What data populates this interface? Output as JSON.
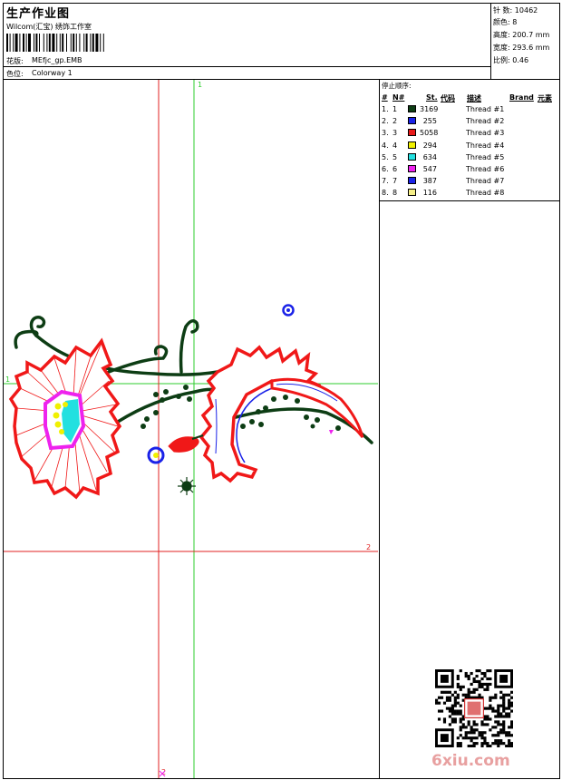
{
  "header": {
    "title": "生产作业图",
    "studio": "Wilcom(汇宝) 绣饰工作室",
    "design_label": "花版:",
    "design_name": "MEfjc_gp.EMB",
    "colorway_label": "色位:",
    "colorway_name": "Colorway 1"
  },
  "stats": [
    {
      "label": "针 数:",
      "value": "10462"
    },
    {
      "label": "颜色:",
      "value": "8"
    },
    {
      "label": "高度:",
      "value": "200.7 mm"
    },
    {
      "label": "宽度:",
      "value": "293.6 mm"
    },
    {
      "label": "比例:",
      "value": "0.46"
    }
  ],
  "stop_sequence": {
    "title": "停止顺序:",
    "columns": [
      "#",
      "N#",
      "St.",
      "代码",
      "描述",
      "Brand",
      "元素"
    ],
    "rows": [
      {
        "idx": "1.",
        "n": "1",
        "color": "#0d3d14",
        "stitches": "3169",
        "desc": "Thread #1"
      },
      {
        "idx": "2.",
        "n": "2",
        "color": "#1a22e8",
        "stitches": "255",
        "desc": "Thread #2"
      },
      {
        "idx": "3.",
        "n": "3",
        "color": "#e81a1a",
        "stitches": "5058",
        "desc": "Thread #3"
      },
      {
        "idx": "4.",
        "n": "4",
        "color": "#f0f000",
        "stitches": "294",
        "desc": "Thread #4"
      },
      {
        "idx": "5.",
        "n": "5",
        "color": "#22e0e0",
        "stitches": "634",
        "desc": "Thread #5"
      },
      {
        "idx": "6.",
        "n": "6",
        "color": "#ee22ee",
        "stitches": "547",
        "desc": "Thread #6"
      },
      {
        "idx": "7.",
        "n": "7",
        "color": "#1a22e8",
        "stitches": "387",
        "desc": "Thread #7"
      },
      {
        "idx": "8.",
        "n": "8",
        "color": "#f5ee88",
        "stitches": "116",
        "desc": "Thread #8"
      }
    ]
  },
  "guides": {
    "green_top": "1",
    "green_left": "1",
    "red_right": "2",
    "red_bottom": "2"
  },
  "colors": {
    "green_guide": "#2ecc2e",
    "red_guide": "#e02020",
    "dark_green": "#0d3d14",
    "red": "#f01818",
    "blue": "#1a22e8",
    "magenta": "#ee22ee",
    "cyan": "#22e0e0",
    "yellow": "#f0f000"
  },
  "watermark": {
    "logo_text": "6xiu.com"
  }
}
